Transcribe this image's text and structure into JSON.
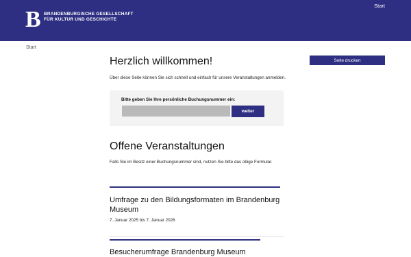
{
  "header": {
    "logo_letter": "B",
    "org_line1": "BRANDENBURGISCHE GESELLSCHAFT",
    "org_line2": "FÜR KULTUR UND GESCHICHTE",
    "nav_start": "Start"
  },
  "breadcrumb": {
    "start": "Start"
  },
  "welcome": {
    "title": "Herzlich willkommen!",
    "intro": "Über diese Seite können Sie sich schnell und einfach für unsere Veranstaltungen anmelden."
  },
  "booking": {
    "label": "Bitte geben Sie Ihre persönliche Buchungsnummer ein:",
    "input_value": "",
    "button_label": "weiter"
  },
  "print": {
    "label": "Seite drucken"
  },
  "events": {
    "title": "Offene Veranstaltungen",
    "intro": "Falls Sie im Besitz einer Buchungsnummer sind, nutzen Sie bitte das obige Formular.",
    "items": [
      {
        "title": "Umfrage zu den Bildungsformaten im Brandenburg Museum",
        "date": "7. Januar 2025 bis 7. Januar 2026"
      },
      {
        "title": "Besucherumfrage Brandenburg Museum",
        "date": ""
      }
    ]
  },
  "colors": {
    "brand": "#2e2f82",
    "box_bg": "#f3f3f3",
    "input_bg": "#b9b9b9"
  }
}
